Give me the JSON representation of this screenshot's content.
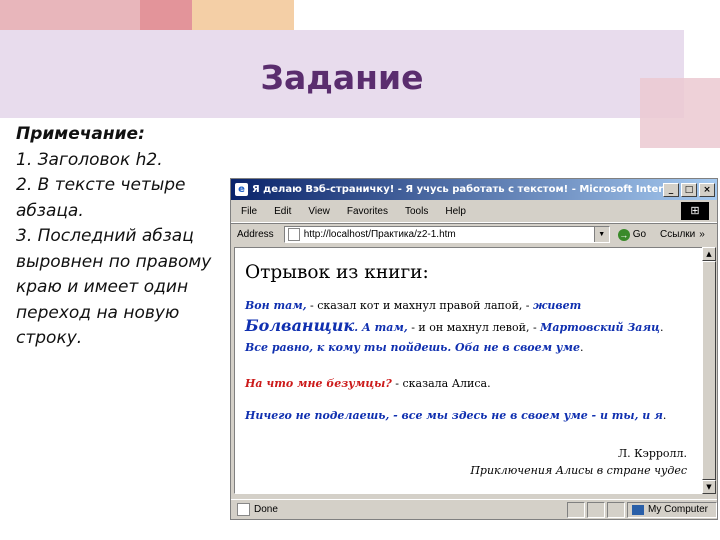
{
  "slide": {
    "title": "Задание",
    "colors": {
      "title": "#5a2d6e",
      "band": "#e8dced",
      "accent_red": "#e0a0a8",
      "accent_orange": "#f2c29a"
    }
  },
  "note": {
    "heading": "Примечание:",
    "lines": [
      "1. Заголовок h2.",
      "2. В тексте четыре",
      "абзаца.",
      "3. Последний абзац",
      "выровнен по правому",
      "краю и имеет один",
      "переход на новую",
      "строку."
    ]
  },
  "browser": {
    "title": "Я делаю Вэб-страничку! - Я учусь работать с текстом! - Microsoft Internet ...",
    "buttons": {
      "minimize": "_",
      "maximize": "□",
      "close": "×"
    },
    "menu": [
      "File",
      "Edit",
      "View",
      "Favorites",
      "Tools",
      "Help"
    ],
    "address_label": "Address",
    "address_value": "http://localhost/Практика/z2-1.htm",
    "go_label": "Go",
    "links_label": "Ссылки",
    "links_chevron": "»",
    "status_text": "Done",
    "zone_text": "My Computer"
  },
  "page": {
    "heading": "Отрывок из книги:",
    "p1": {
      "l1_blue": "Вон там,",
      "l1_plain": " - сказал кот и махнул правой лапой, - ",
      "l1_blue2": "живет",
      "l2_big": "Болванщик",
      "l2_blue": ". А там,",
      "l2_plain": " - и он махнул левой, - ",
      "l2_blue2": "Мартовский Заяц",
      "l2_end": ".",
      "l3_blue": "Все равно, к кому ты пойдешь. Оба не в своем уме",
      "l3_end": "."
    },
    "p2": {
      "red": "На что мне безумцы?",
      "plain": " - сказала Алиса."
    },
    "p3": {
      "blue": "Ничего не поделаешь, - все мы здесь не в своем уме - и ты, и я",
      "end": "."
    },
    "p4": {
      "author": "Л. Кэрролл.",
      "book": "Приключения Алисы в стране чудес"
    }
  }
}
